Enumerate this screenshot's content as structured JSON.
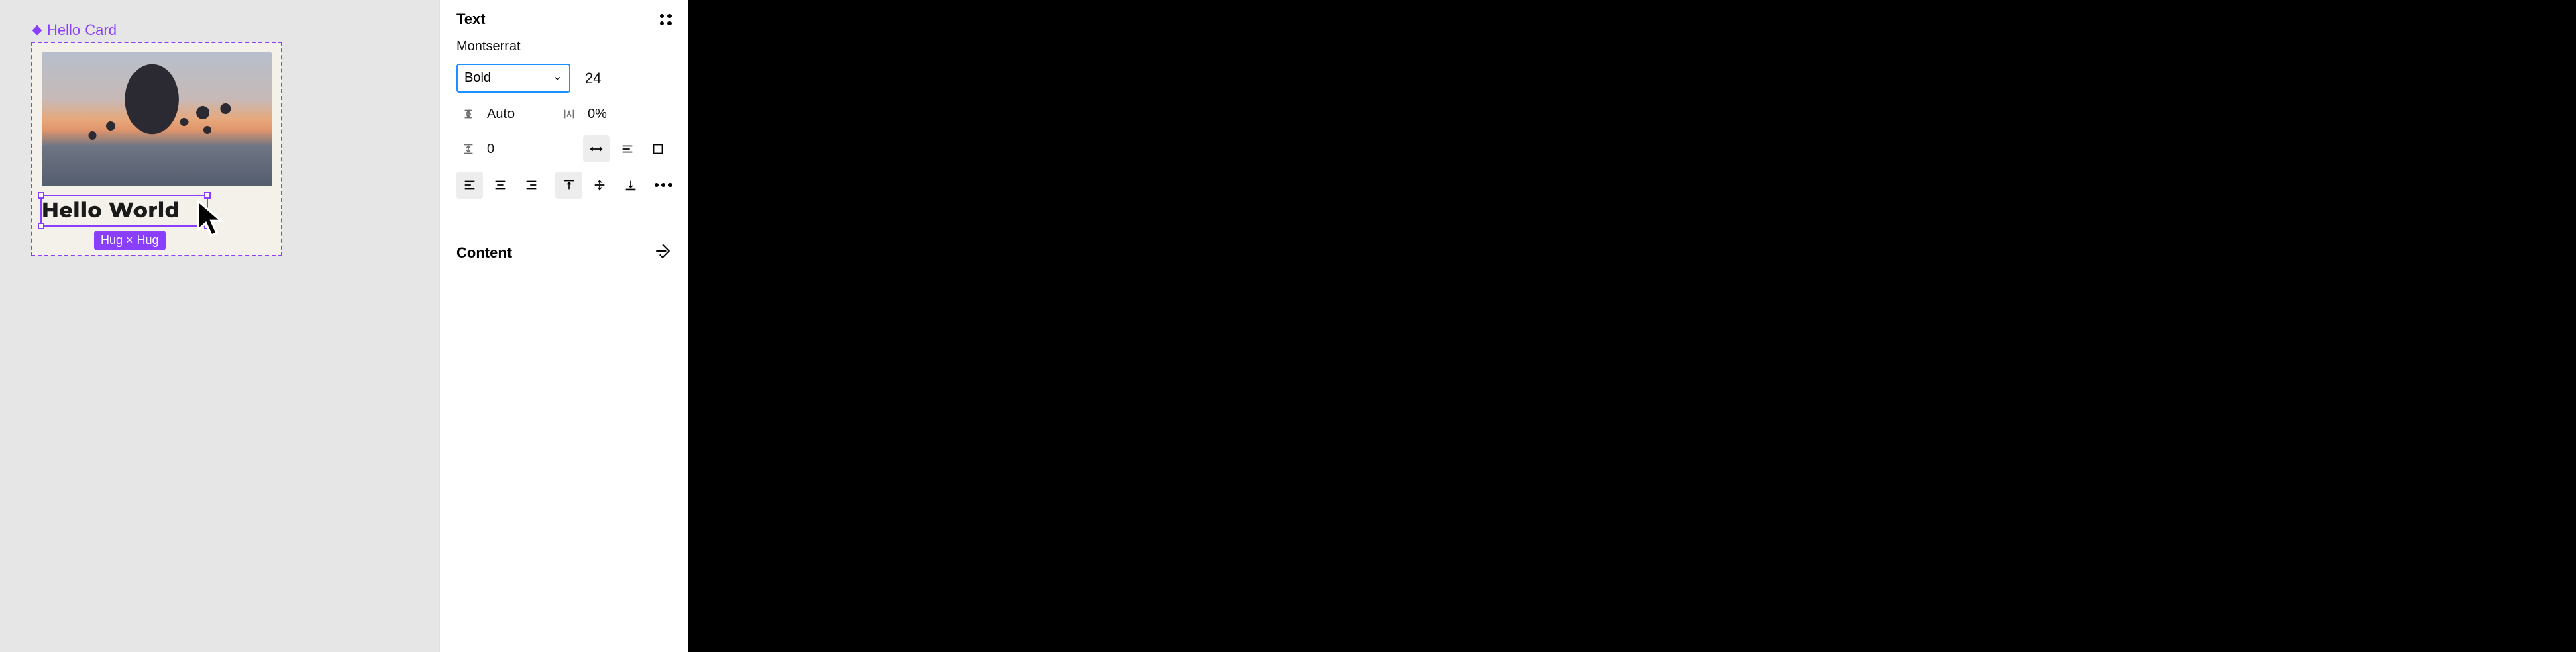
{
  "canvas": {
    "component_label": "Hello Card",
    "text_content": "Hello World",
    "size_badge": "Hug × Hug"
  },
  "panel": {
    "text_section_title": "Text",
    "font_family": "Montserrat",
    "font_weight": "Bold",
    "font_size": "24",
    "line_height_label": "Auto",
    "letter_spacing_label": "0%",
    "paragraph_spacing": "0",
    "content_section_title": "Content"
  }
}
